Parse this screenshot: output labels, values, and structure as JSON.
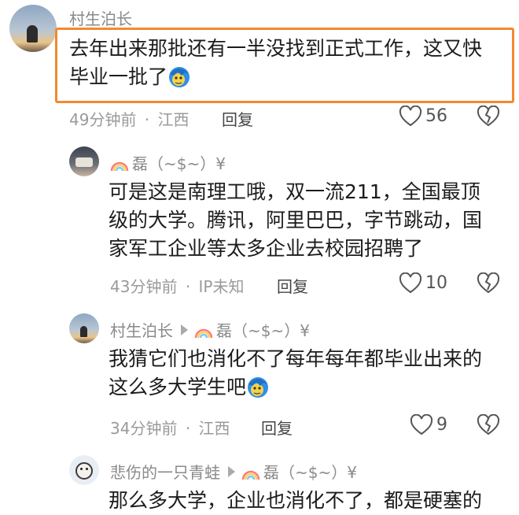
{
  "comments": [
    {
      "author": "村生泊长",
      "text_line1": "去年出来那批还有一半没找到正式工作，这又快",
      "text_line2": "毕业一批了",
      "time": "49分钟前",
      "location": "江西",
      "reply_label": "回复",
      "likes": "56"
    },
    {
      "author": "磊（~$~）¥",
      "text_line1": "可是这是南理工哦，双一流211，全国最顶",
      "text_line2": "级的大学。腾讯，阿里巴巴，字节跳动，国",
      "text_line3": "家军工企业等太多企业去校园招聘了",
      "time": "43分钟前",
      "location": "IP未知",
      "reply_label": "回复",
      "likes": "10"
    },
    {
      "author": "村生泊长",
      "reply_to": "磊（~$~）¥",
      "text_line1": "我猜它们也消化不了每年每年都毕业出来的",
      "text_line2": "这么多大学生吧",
      "time": "34分钟前",
      "location": "江西",
      "reply_label": "回复",
      "likes": "9"
    },
    {
      "author": "悲伤的一只青蛙",
      "reply_to": "磊（~$~）¥",
      "text_line1": "那么多大学，企业也消化不了，都是硬塞的"
    }
  ],
  "meta_separator": "·",
  "icons": {
    "like": "heart-outline-icon",
    "dislike": "broken-heart-icon",
    "reply_arrow": "triangle-right-icon",
    "emoji": "blue-hair-emoji-icon",
    "rainbow": "rainbow-icon"
  },
  "colors": {
    "highlight": "#f08a32",
    "meta": "#9a9a9a",
    "name": "#8a8a8a"
  }
}
